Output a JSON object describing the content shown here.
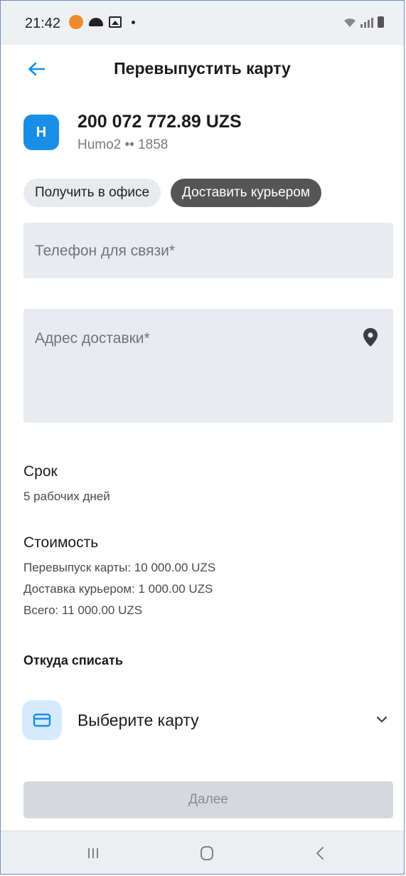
{
  "status_bar": {
    "time": "21:42"
  },
  "header": {
    "title": "Перевыпустить карту"
  },
  "card": {
    "logo_letter": "H",
    "balance": "200 072 772.89 UZS",
    "subtitle": "Humo2 •• 1858"
  },
  "delivery_options": [
    {
      "label": "Получить в офисе",
      "selected": false
    },
    {
      "label": "Доставить курьером",
      "selected": true
    }
  ],
  "form": {
    "phone_placeholder": "Телефон для связи*",
    "address_placeholder": "Адрес доставки*"
  },
  "term": {
    "title": "Срок",
    "value": "5 рабочих дней"
  },
  "cost": {
    "title": "Стоимость",
    "lines": [
      "Перевыпуск карты: 10 000.00 UZS",
      "Доставка курьером: 1 000.00 UZS",
      "Всего: 11 000.00 UZS"
    ]
  },
  "source": {
    "title": "Откуда списать",
    "select_label": "Выберите карту"
  },
  "next_button": {
    "label": "Далее",
    "enabled": false
  },
  "colors": {
    "accent": "#1a8ee6",
    "active_chip": "#555557",
    "field_bg": "#e8ebef"
  },
  "icons": [
    "back-arrow-icon",
    "location-pin-icon",
    "card-icon",
    "chevron-down-icon"
  ]
}
